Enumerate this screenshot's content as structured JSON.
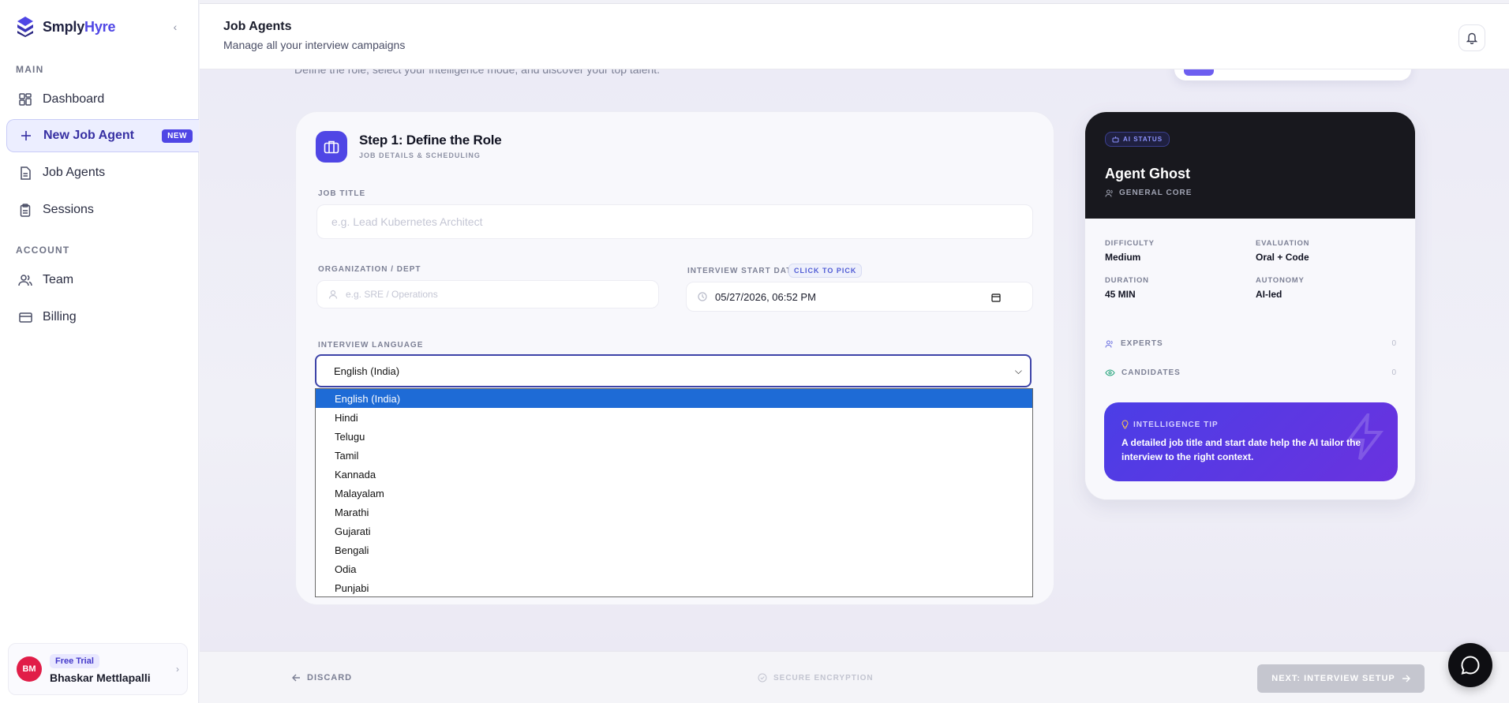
{
  "brand": {
    "name_main": "Smply",
    "name_accent": "Hyre"
  },
  "sidebar": {
    "section_main": "MAIN",
    "section_account": "ACCOUNT",
    "items": [
      {
        "label": "Dashboard",
        "icon": "dashboard-icon"
      },
      {
        "label": "New Job Agent",
        "icon": "plus-icon",
        "badge": "NEW",
        "active": true
      },
      {
        "label": "Job Agents",
        "icon": "document-icon"
      },
      {
        "label": "Sessions",
        "icon": "clipboard-icon"
      },
      {
        "label": "Team",
        "icon": "users-icon"
      },
      {
        "label": "Billing",
        "icon": "credit-card-icon"
      }
    ],
    "user": {
      "initials": "BM",
      "plan": "Free Trial",
      "name": "Bhaskar Mettlapalli"
    }
  },
  "header": {
    "title": "Job Agents",
    "subtitle": "Manage all your interview campaigns"
  },
  "main": {
    "intro": "Define the role, select your intelligence mode, and discover your top talent.",
    "step": {
      "title": "Step 1: Define the Role",
      "subtitle": "JOB DETAILS & SCHEDULING"
    },
    "job_title": {
      "label": "JOB TITLE",
      "placeholder": "e.g. Lead Kubernetes Architect"
    },
    "org": {
      "label": "ORGANIZATION / DEPT",
      "placeholder": "e.g. SRE / Operations"
    },
    "start_date": {
      "label": "INTERVIEW START DATE",
      "badge": "CLICK TO PICK",
      "value": "05/27/2026, 06:52 PM"
    },
    "language": {
      "label": "INTERVIEW LANGUAGE",
      "selected": "English (India)",
      "options": [
        "English (India)",
        "Hindi",
        "Telugu",
        "Tamil",
        "Kannada",
        "Malayalam",
        "Marathi",
        "Gujarati",
        "Bengali",
        "Odia",
        "Punjabi"
      ]
    }
  },
  "agent": {
    "status": "AI STATUS",
    "name": "Agent Ghost",
    "core": "GENERAL CORE",
    "stats": {
      "difficulty_label": "DIFFICULTY",
      "difficulty": "Medium",
      "evaluation_label": "EVALUATION",
      "evaluation": "Oral + Code",
      "duration_label": "DURATION",
      "duration": "45 MIN",
      "autonomy_label": "AUTONOMY",
      "autonomy": "AI-led"
    },
    "experts_label": "EXPERTS",
    "experts_count": "0",
    "candidates_label": "CANDIDATES",
    "candidates_count": "0",
    "tip_label": "INTELLIGENCE TIP",
    "tip_text": "A detailed job title and start date help the AI tailor the interview to the right context."
  },
  "footer": {
    "discard": "DISCARD",
    "secure": "SECURE ENCRYPTION",
    "next": "NEXT: INTERVIEW SETUP"
  },
  "colors": {
    "accent": "#4f46e5",
    "selected_option": "#1e6bd6",
    "avatar": "#e11d48"
  }
}
